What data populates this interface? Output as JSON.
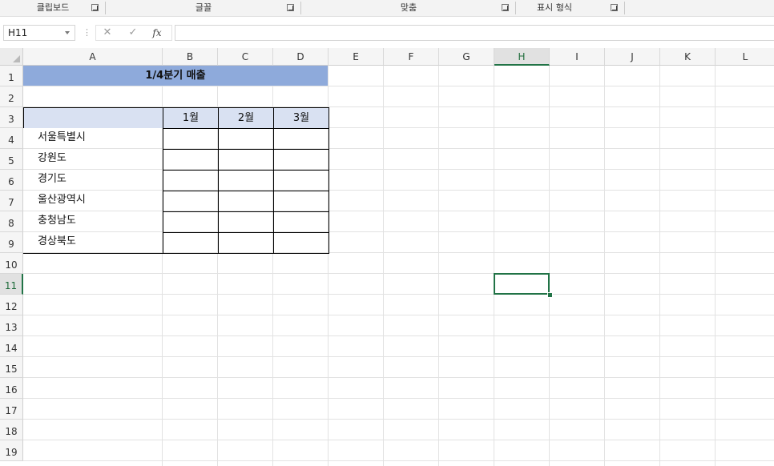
{
  "ribbon": {
    "groups": [
      {
        "label": "클립보드"
      },
      {
        "label": "글꼴"
      },
      {
        "label": "맞춤"
      },
      {
        "label": "표시 형식"
      }
    ]
  },
  "formula_bar": {
    "name_box": "H11",
    "cancel_icon": "✕",
    "enter_icon": "✓",
    "fx_label": "fx",
    "formula": ""
  },
  "sheet": {
    "columns": [
      "A",
      "B",
      "C",
      "D",
      "E",
      "F",
      "G",
      "H",
      "I",
      "J",
      "K",
      "L"
    ],
    "rows": [
      "1",
      "2",
      "3",
      "4",
      "5",
      "6",
      "7",
      "8",
      "9",
      "10",
      "11",
      "12",
      "13",
      "14",
      "15",
      "16",
      "17",
      "18",
      "19"
    ],
    "active_cell": "H11",
    "title": "1/4분기 매출",
    "month_headers": [
      "1월",
      "2월",
      "3월"
    ],
    "regions": [
      "서울특별시",
      "강원도",
      "경기도",
      "울산광역시",
      "충청남도",
      "경상북도"
    ]
  },
  "colors": {
    "title_fill": "#8eaadb",
    "header_fill": "#d9e1f2",
    "selection": "#217346"
  }
}
